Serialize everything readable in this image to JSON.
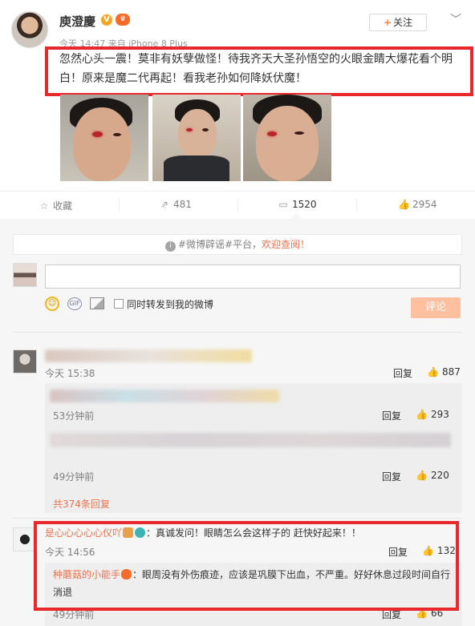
{
  "post": {
    "user_name": "庾澄慶",
    "verified_badge": "V",
    "vip_badge": "会员",
    "follow_label": "关注",
    "meta": "今天 14:47 来自 iPhone 8 Plus",
    "text": "忽然心头一震！莫非有妖孽做怪！待我齐天大圣孙悟空的火眼金睛大爆花看个明白！原来是魔二代再起！看我老孙如何降妖伏魔！",
    "photos": 3
  },
  "stats": {
    "favorite_label": "收藏",
    "repost_count": "481",
    "comment_count": "1520",
    "like_count": "2954"
  },
  "comment_box": {
    "notice_prefix": "#微博辟谣#平台，",
    "notice_link": "欢迎查阅！",
    "repost_label": "同时转发到我的微博",
    "submit_label": "评论"
  },
  "comments": [
    {
      "time": "今天 15:38",
      "reply_label": "回复",
      "likes": "887",
      "replies": [
        {
          "time": "53分钟前",
          "reply_label": "回复",
          "likes": "293"
        },
        {
          "time": "49分钟前",
          "reply_label": "回复",
          "likes": "220"
        }
      ],
      "more_replies": "共374条回复"
    },
    {
      "user": "是心心心心心仪吖",
      "text": "：真诚发问！眼睛怎么会这样子的 赶快好起来！！",
      "time": "今天 14:56",
      "reply_label": "回复",
      "likes": "132",
      "replies": [
        {
          "user": "种蘑菇的小能手",
          "text": "：眼周没有外伤痕迹，应该是巩膜下出血，不严重。好好休息过段时间自行消退",
          "time": "49分钟前",
          "reply_label": "回复",
          "likes": "66"
        }
      ]
    }
  ],
  "colors": {
    "highlight_border": "#e8282d",
    "accent_orange": "#eb7350",
    "submit_disabled": "#ffc09f"
  }
}
